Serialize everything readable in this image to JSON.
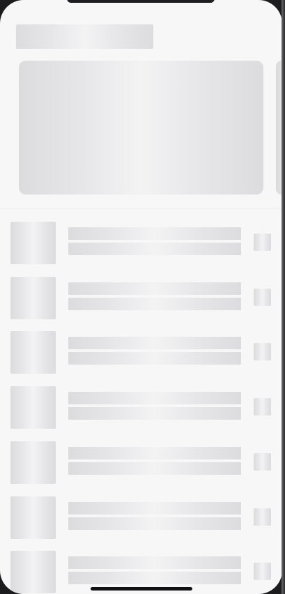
{
  "screen": {
    "state": "loading",
    "status_bar": {},
    "header": {
      "title": ""
    },
    "hero": {
      "title": ""
    },
    "list": {
      "items": [
        {
          "title": "",
          "subtitle": ""
        },
        {
          "title": "",
          "subtitle": ""
        },
        {
          "title": "",
          "subtitle": ""
        },
        {
          "title": "",
          "subtitle": ""
        },
        {
          "title": "",
          "subtitle": ""
        },
        {
          "title": "",
          "subtitle": ""
        },
        {
          "title": "",
          "subtitle": ""
        }
      ]
    }
  },
  "colors": {
    "background": "#f7f7f8",
    "skeleton_base": "#dcdcde",
    "skeleton_highlight": "#f3f3f4",
    "device_frame": "#1c1c1e"
  }
}
